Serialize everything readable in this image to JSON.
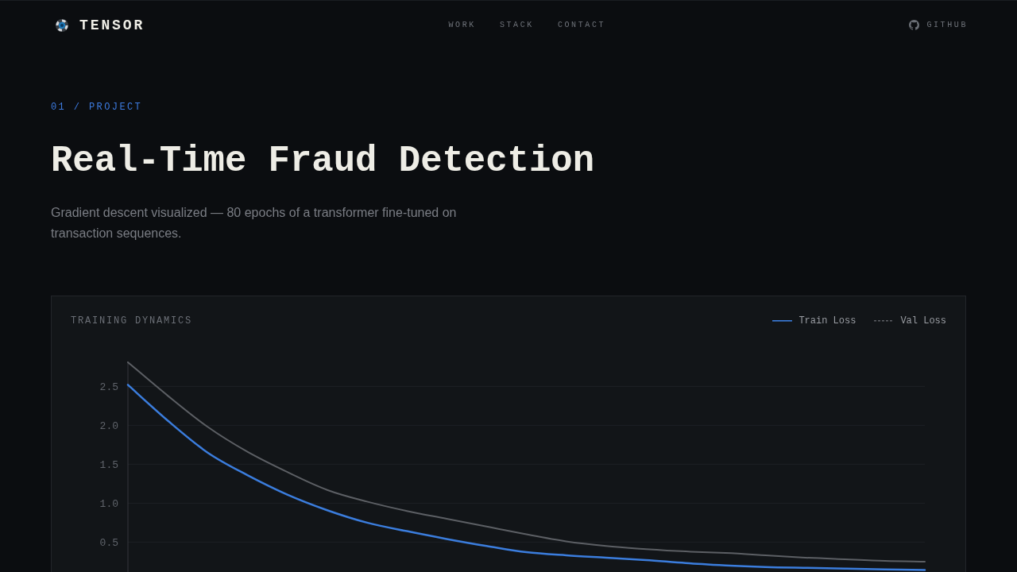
{
  "header": {
    "logo": "TENSOR",
    "nav": [
      "WORK",
      "STACK",
      "CONTACT"
    ],
    "github": "GITHUB"
  },
  "hero": {
    "eyebrow": "01 / PROJECT",
    "title": "Real-Time Fraud Detection",
    "description": "Gradient descent visualized — 80 epochs of a transformer fine-tuned on transaction sequences."
  },
  "panel": {
    "chart_data": [
      {
        "type": "line",
        "title": "TRAINING DYNAMICS",
        "legend": "top-right",
        "grid": "y",
        "tick_labels": "y",
        "ylim": [
          0,
          2.82
        ],
        "yticks": [
          {
            "value": 0.5,
            "label": "0.5"
          },
          {
            "value": 1,
            "label": "1.0"
          },
          {
            "value": 1.5,
            "label": "1.5"
          },
          {
            "value": 2,
            "label": "2.0"
          },
          {
            "value": 2.5,
            "label": "2.5"
          }
        ],
        "categories": [
          null,
          null,
          null,
          null,
          null,
          null,
          null,
          null,
          null,
          null,
          null,
          null,
          null,
          null,
          null,
          null,
          null,
          null,
          null,
          null,
          null
        ],
        "series": [
          {
            "name": "Train Loss",
            "color": "#3b7ddd",
            "values": [
              2.52,
              2.06,
              1.65,
              1.36,
              1.11,
              0.91,
              0.75,
              0.64,
              0.54,
              0.45,
              0.37,
              0.33,
              0.3,
              0.27,
              0.23,
              0.2,
              0.18,
              0.17,
              0.16,
              0.15,
              0.14
            ]
          },
          {
            "name": "Val Loss",
            "color": "#5c5f64",
            "values": [
              2.81,
              2.38,
              1.98,
              1.66,
              1.4,
              1.17,
              1.02,
              0.9,
              0.8,
              0.7,
              0.6,
              0.51,
              0.45,
              0.41,
              0.38,
              0.36,
              0.33,
              0.3,
              0.28,
              0.26,
              0.25
            ]
          }
        ]
      }
    ]
  }
}
